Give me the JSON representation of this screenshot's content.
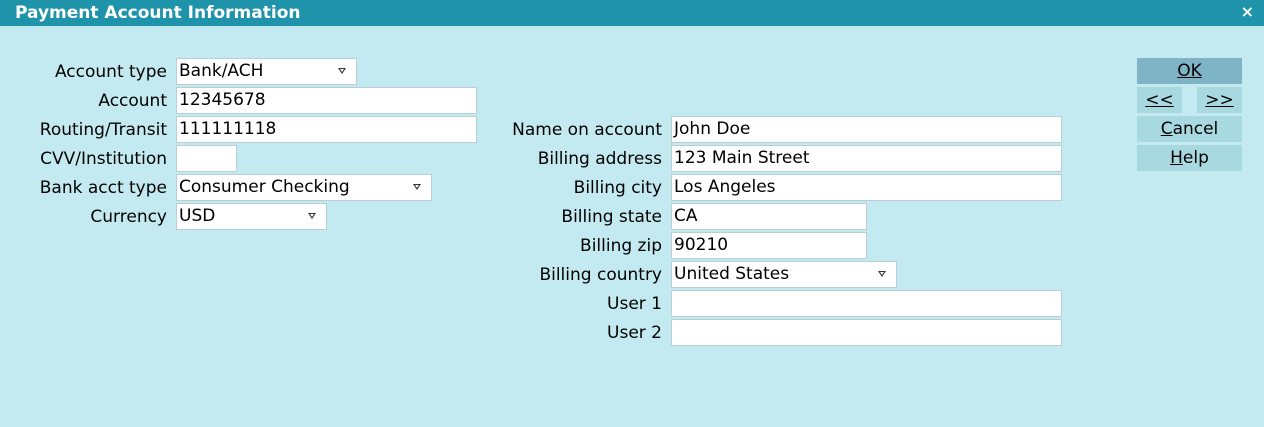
{
  "window": {
    "title": "Payment Account Information",
    "close_glyph": "×"
  },
  "left": {
    "account_type": {
      "label": "Account type",
      "value": "Bank/ACH"
    },
    "account": {
      "label": "Account",
      "value": "12345678"
    },
    "routing": {
      "label": "Routing/Transit",
      "value": "111111118"
    },
    "cvv": {
      "label": "CVV/Institution",
      "value": ""
    },
    "bank_acct_type": {
      "label": "Bank acct type",
      "value": "Consumer Checking"
    },
    "currency": {
      "label": "Currency",
      "value": "USD"
    }
  },
  "right": {
    "name_on_account": {
      "label": "Name on account",
      "value": "John Doe"
    },
    "billing_address": {
      "label": "Billing address",
      "value": "123 Main Street"
    },
    "billing_city": {
      "label": "Billing city",
      "value": "Los Angeles"
    },
    "billing_state": {
      "label": "Billing state",
      "value": "CA"
    },
    "billing_zip": {
      "label": "Billing zip",
      "value": "90210"
    },
    "billing_country": {
      "label": "Billing country",
      "value": "United States"
    },
    "user1": {
      "label": "User 1",
      "value": ""
    },
    "user2": {
      "label": "User 2",
      "value": ""
    }
  },
  "buttons": {
    "ok": "OK",
    "prev": "<<",
    "next": ">>",
    "cancel": "Cancel",
    "help": "Help"
  }
}
